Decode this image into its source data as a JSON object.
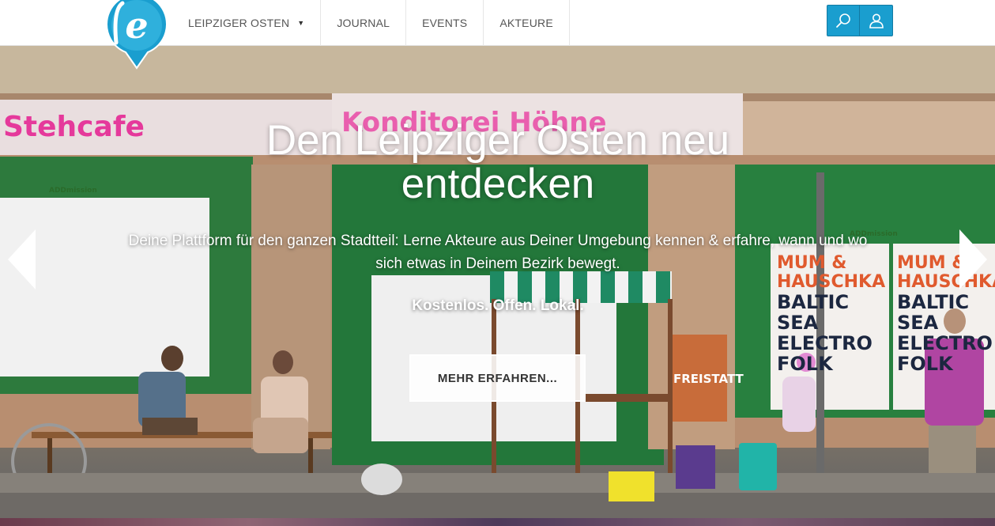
{
  "nav": {
    "items": [
      {
        "label": "LEIPZIGER OSTEN",
        "has_dropdown": true
      },
      {
        "label": "JOURNAL"
      },
      {
        "label": "EVENTS"
      },
      {
        "label": "AKTEURE"
      }
    ],
    "dropdown_caret": "▼"
  },
  "tools": {
    "search_icon": "search-icon",
    "user_icon": "user-icon",
    "accent_color": "#1a9ecf"
  },
  "hero": {
    "title": "Den Leipziger Osten neu entdecken",
    "subtitle": "Deine Plattform für den ganzen Stadtteil: Lerne Akteure aus Deiner Umgebung kennen & erfahre, wann und wo sich etwas in Deinem Bezirk bewegt.",
    "claim": "Kostenlos. Offen. Lokal.",
    "cta_label": "MEHR ERFAHREN...",
    "photo_signs": {
      "stehcafe": "Stehcafe",
      "konditorei": "Konditorei Höhne",
      "addmission": "ADDmission",
      "poster_band": "MUM & HAUSCHKA",
      "poster_event": "BALTIC SEA ELECTRO FOLK",
      "poster_freistatt": "FREISTATT"
    }
  },
  "logo": {
    "letter": "e",
    "color": "#1a9ecf"
  }
}
